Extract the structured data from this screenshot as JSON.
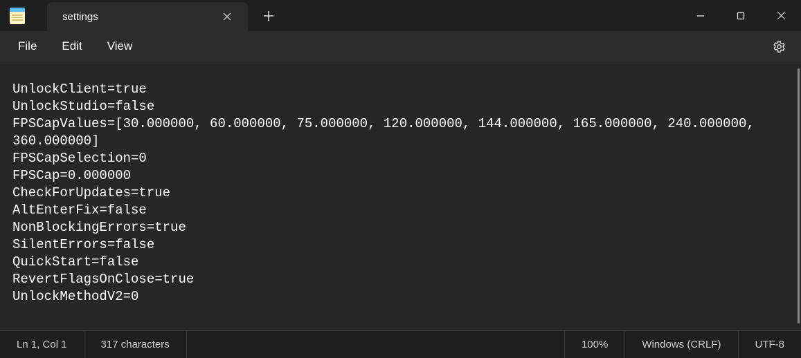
{
  "tab": {
    "title": "settings"
  },
  "menus": {
    "file": "File",
    "edit": "Edit",
    "view": "View"
  },
  "editor": {
    "content": "UnlockClient=true\nUnlockStudio=false\nFPSCapValues=[30.000000, 60.000000, 75.000000, 120.000000, 144.000000, 165.000000, 240.000000, 360.000000]\nFPSCapSelection=0\nFPSCap=0.000000\nCheckForUpdates=true\nAltEnterFix=false\nNonBlockingErrors=true\nSilentErrors=false\nQuickStart=false\nRevertFlagsOnClose=true\nUnlockMethodV2=0"
  },
  "statusbar": {
    "position": "Ln 1, Col 1",
    "charcount": "317 characters",
    "zoom": "100%",
    "line_endings": "Windows (CRLF)",
    "encoding": "UTF-8"
  }
}
